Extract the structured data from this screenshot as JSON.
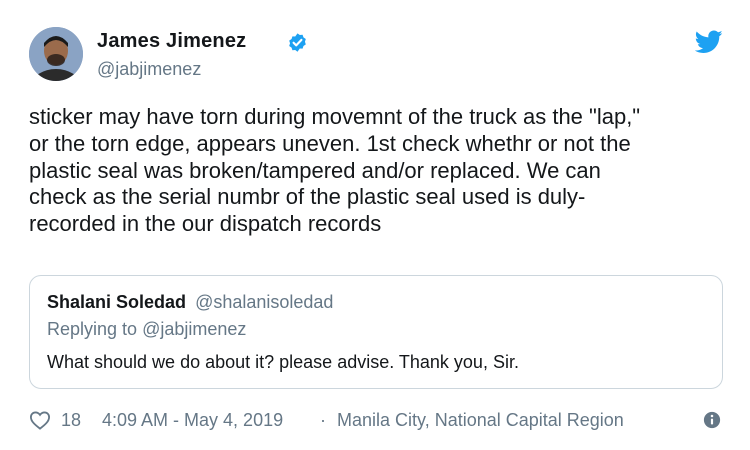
{
  "author": {
    "name": "James Jimenez",
    "handle": "@jabjimenez",
    "verified_icon": "verified-badge-icon",
    "brand_color": "#1da1f2"
  },
  "tweet": {
    "lines": [
      "sticker may have torn during movemnt of the truck as the \"lap,\"",
      "or the torn edge, appears uneven. 1st check whethr or not the",
      "plastic seal was broken/tampered and/or replaced. We can",
      "check as the serial numbr of the plastic seal used is duly-",
      "recorded in the our dispatch records"
    ]
  },
  "quoted_tweet": {
    "name": "Shalani Soledad",
    "handle": "@shalanisoledad",
    "replying_prefix": "Replying to ",
    "replying_to": "@jabjimenez",
    "text": "What should we do about it? please advise. Thank you, Sir."
  },
  "footer": {
    "like_icon": "heart-icon",
    "like_count": "18",
    "timestamp": "4:09 AM - May 4, 2019",
    "separator": "·",
    "location": "Manila City, National Capital Region",
    "info_icon": "info-icon"
  }
}
